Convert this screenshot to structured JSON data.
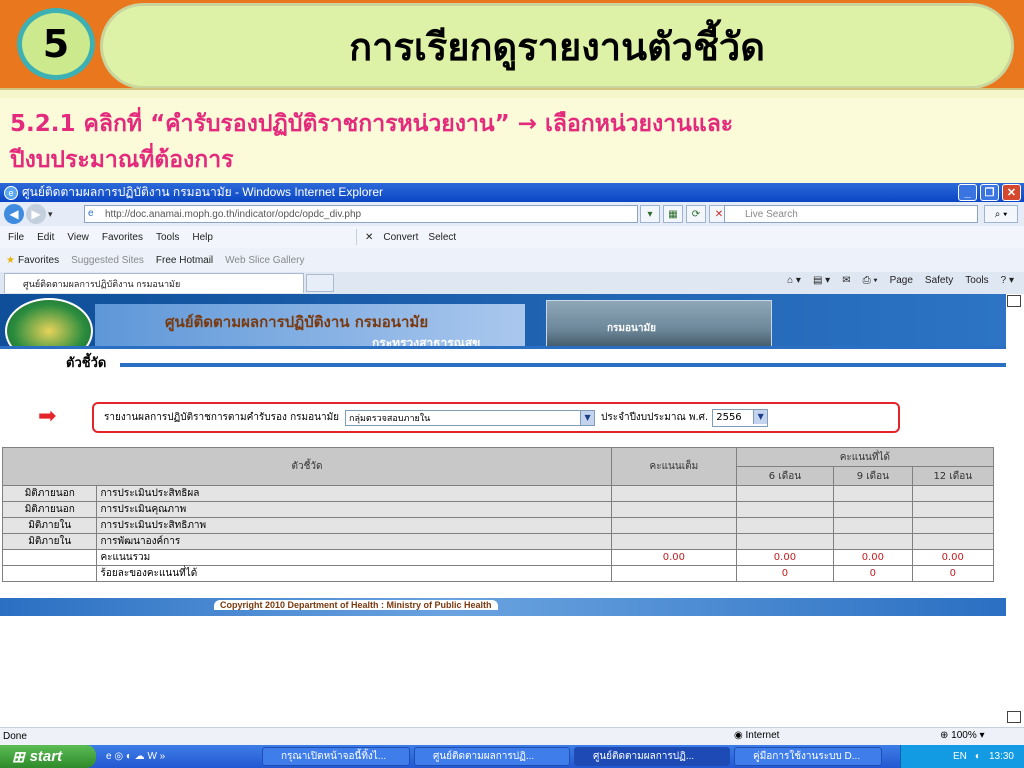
{
  "slide": {
    "number": "5",
    "title": "การเรียกดูรายงานตัวชี้วัด",
    "subtitle_line1": "5.2.1 คลิกที่ “คำรับรองปฏิบัติราชการหน่วยงาน” → เลือกหน่วยงานและ",
    "subtitle_line2": "ปีงบประมาณที่ต้องการ"
  },
  "browser": {
    "window_title": "ศูนย์ติดตามผลการปฏิบัติงาน กรมอนามัย - Windows Internet Explorer",
    "url": "http://doc.anamai.moph.go.th/indicator/opdc/opdc_div.php",
    "search_placeholder": "Live Search",
    "menu": [
      "File",
      "Edit",
      "View",
      "Favorites",
      "Tools",
      "Help"
    ],
    "toolbar_convert": "Convert",
    "toolbar_select": "Select",
    "favorites_label": "Favorites",
    "fav_suggested": "Suggested Sites",
    "fav_hotmail": "Free Hotmail",
    "fav_webslice": "Web Slice Gallery",
    "tab_label": "ศูนย์ติดตามผลการปฏิบัติงาน กรมอนามัย",
    "cmd_page": "Page",
    "cmd_safety": "Safety",
    "cmd_tools": "Tools",
    "status_text": "Done",
    "status_zone": "Internet",
    "status_zoom": "100%"
  },
  "site": {
    "org_name": "ศูนย์ติดตามผลการปฏิบัติงาน กรมอนามัย",
    "ministry": "กระทรวงสาธารณสุข",
    "photo_caption": "กรมอนามัย",
    "section_label": "ตัวชี้วัด",
    "filter_label": "รายงานผลการปฏิบัติราชการตามคำรับรอง กรมอนามัย",
    "org_select_value": "กลุ่มตรวจสอบภายใน",
    "year_label": "ประจำปีงบประมาณ พ.ศ.",
    "year_value": "2556",
    "footer": "Copyright 2010 Department of Health : Ministry of Public Health"
  },
  "table": {
    "header_indicator": "ตัวชี้วัด",
    "header_full": "คะแนนเต็ม",
    "header_score": "คะแนนที่ได้",
    "header_6m": "6 เดือน",
    "header_9m": "9 เดือน",
    "header_12m": "12 เดือน",
    "rows": [
      {
        "dim": "มิติภายนอก",
        "name": "การประเมินประสิทธิผล"
      },
      {
        "dim": "มิติภายนอก",
        "name": "การประเมินคุณภาพ"
      },
      {
        "dim": "มิติภายใน",
        "name": "การประเมินประสิทธิภาพ"
      },
      {
        "dim": "มิติภายใน",
        "name": "การพัฒนาองค์การ"
      }
    ],
    "total_label": "คะแนนรวม",
    "total_full": "0.00",
    "total_6m": "0.00",
    "total_9m": "0.00",
    "total_12m": "0.00",
    "percent_label": "ร้อยละของคะแนนที่ได้",
    "percent_6m": "0",
    "percent_9m": "0",
    "percent_12m": "0"
  },
  "taskbar": {
    "start": "start",
    "items": [
      "กรุณาเปิดหน้าจอนี้ทิ้งไ...",
      "ศูนย์ติดตามผลการปฏิ...",
      "ศูนย์ติดตามผลการปฏิ...",
      "คู่มือการใช้งานระบบ D..."
    ],
    "lang": "EN",
    "time": "13:30"
  }
}
